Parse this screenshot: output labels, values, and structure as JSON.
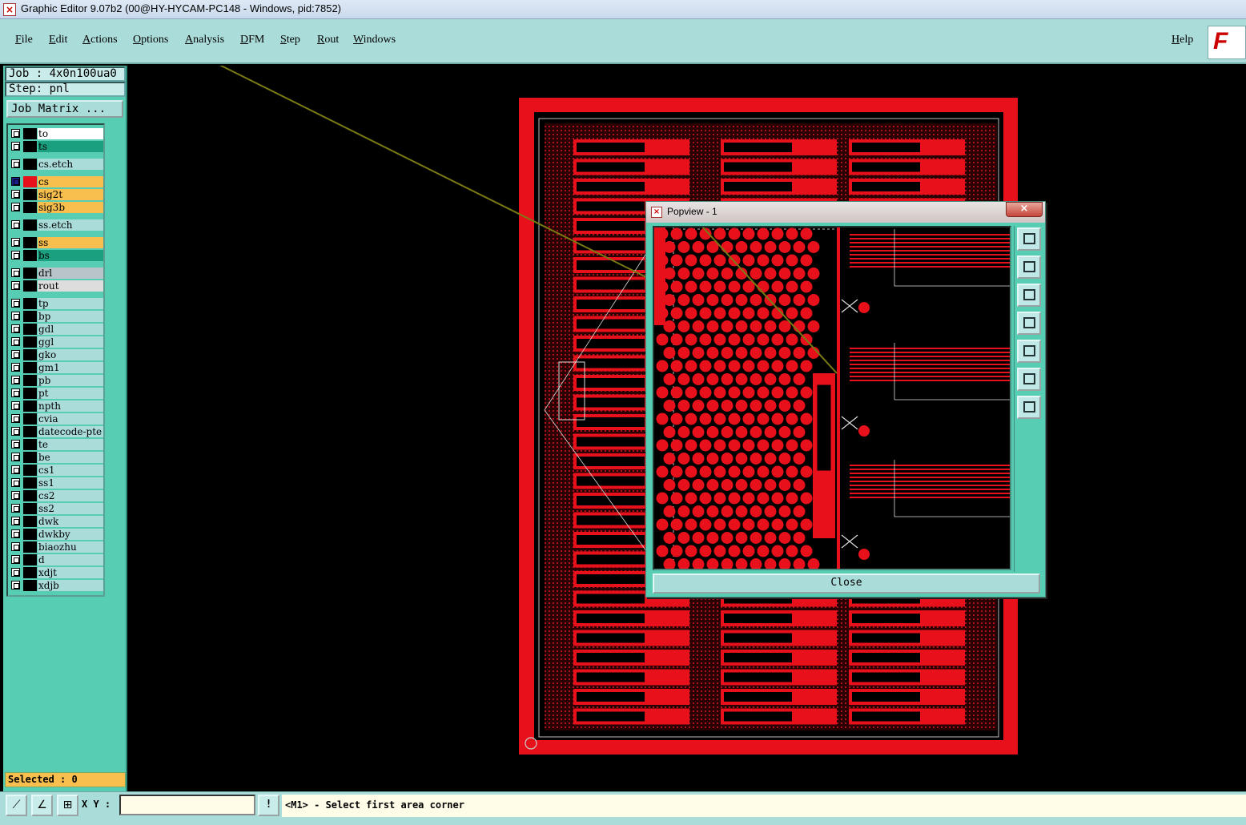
{
  "window": {
    "title": "Graphic Editor 9.07b2 (00@HY-HYCAM-PC148 - Windows, pid:7852)"
  },
  "menu": {
    "items": [
      "File",
      "Edit",
      "Actions",
      "Options",
      "Analysis",
      "DFM",
      "Step",
      "Rout",
      "Windows"
    ],
    "help": "Help",
    "brand": "F"
  },
  "left_panel": {
    "job": "Job : 4x0n100ua0",
    "step": "Step: pnl",
    "job_matrix": "Job Matrix ...",
    "selected": "Selected : 0"
  },
  "layers": [
    {
      "name": "to",
      "bg": "#ffffff",
      "swatch": "#000000"
    },
    {
      "name": "ts",
      "bg": "#1aa07e",
      "swatch": "#000000"
    },
    {
      "name": "cs.etch",
      "bg": "#aadcda",
      "swatch": "#000000"
    },
    {
      "name": "cs",
      "bg": "#f8bf4e",
      "swatch": "#e8111b",
      "active": true
    },
    {
      "name": "sig2t",
      "bg": "#f8bf4e",
      "swatch": "#000000"
    },
    {
      "name": "sig3b",
      "bg": "#f8bf4e",
      "swatch": "#000000"
    },
    {
      "name": "ss.etch",
      "bg": "#aadcda",
      "swatch": "#000000"
    },
    {
      "name": "ss",
      "bg": "#f8bf4e",
      "swatch": "#000000"
    },
    {
      "name": "bs",
      "bg": "#1aa07e",
      "swatch": "#000000"
    },
    {
      "name": "drl",
      "bg": "#b8c4c9",
      "swatch": "#000000"
    },
    {
      "name": "rout",
      "bg": "#dddddd",
      "swatch": "#000000"
    },
    {
      "name": "tp",
      "bg": "#aadcda",
      "swatch": "#000000"
    },
    {
      "name": "bp",
      "bg": "#aadcda",
      "swatch": "#000000"
    },
    {
      "name": "gdl",
      "bg": "#aadcda",
      "swatch": "#000000"
    },
    {
      "name": "ggl",
      "bg": "#aadcda",
      "swatch": "#000000"
    },
    {
      "name": "gko",
      "bg": "#aadcda",
      "swatch": "#000000"
    },
    {
      "name": "gm1",
      "bg": "#aadcda",
      "swatch": "#000000"
    },
    {
      "name": "pb",
      "bg": "#aadcda",
      "swatch": "#000000"
    },
    {
      "name": "pt",
      "bg": "#aadcda",
      "swatch": "#000000"
    },
    {
      "name": "npth",
      "bg": "#aadcda",
      "swatch": "#000000"
    },
    {
      "name": "cvia",
      "bg": "#aadcda",
      "swatch": "#000000"
    },
    {
      "name": "datecode-pte",
      "bg": "#aadcda",
      "swatch": "#000000"
    },
    {
      "name": "te",
      "bg": "#aadcda",
      "swatch": "#000000"
    },
    {
      "name": "be",
      "bg": "#aadcda",
      "swatch": "#000000"
    },
    {
      "name": "cs1",
      "bg": "#aadcda",
      "swatch": "#000000"
    },
    {
      "name": "ss1",
      "bg": "#aadcda",
      "swatch": "#000000"
    },
    {
      "name": "cs2",
      "bg": "#aadcda",
      "swatch": "#000000"
    },
    {
      "name": "ss2",
      "bg": "#aadcda",
      "swatch": "#000000"
    },
    {
      "name": "dwk",
      "bg": "#aadcda",
      "swatch": "#000000"
    },
    {
      "name": "dwkby",
      "bg": "#aadcda",
      "swatch": "#000000"
    },
    {
      "name": "biaozhu",
      "bg": "#aadcda",
      "swatch": "#000000"
    },
    {
      "name": "d",
      "bg": "#aadcda",
      "swatch": "#000000"
    },
    {
      "name": "xdjt",
      "bg": "#aadcda",
      "swatch": "#000000"
    },
    {
      "name": "xdjb",
      "bg": "#aadcda",
      "swatch": "#000000"
    }
  ],
  "popview": {
    "title": "Popview - 1",
    "close_x": "×",
    "close_button": "Close",
    "tools": [
      "zoom-window-icon",
      "pan-up-icon",
      "pan-down-icon",
      "pan-left-icon",
      "pan-right-icon",
      "zoom-fit-icon",
      "move-icon"
    ]
  },
  "status_bar": {
    "xy_label": "X Y :",
    "xy_value": "",
    "excl": "!",
    "prompt": "<M1> - Select first area corner"
  },
  "colors": {
    "copper": "#e8111b",
    "panel_bg": "#57cdb3",
    "menu_bg": "#aadcda",
    "highlight": "#f8bf4e"
  }
}
